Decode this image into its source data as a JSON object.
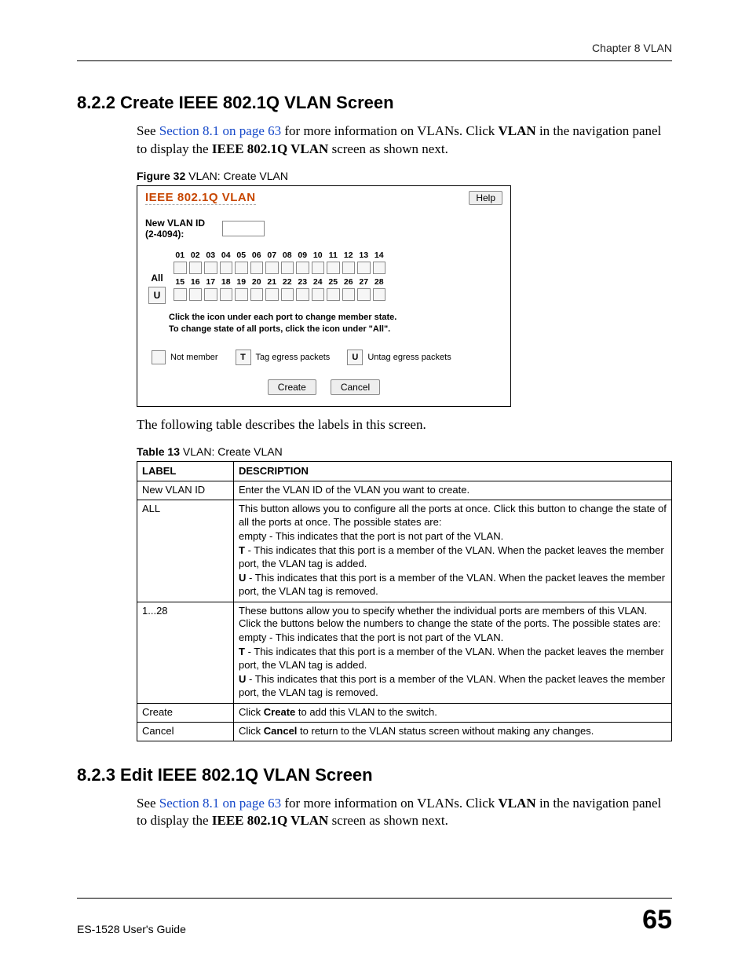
{
  "header": {
    "right": "Chapter 8 VLAN"
  },
  "s1": {
    "heading": "8.2.2  Create IEEE 802.1Q VLAN Screen",
    "p_pre": "See ",
    "p_link": "Section 8.1 on page 63",
    "p_post1": " for more information on VLANs. Click ",
    "p_bold1": "VLAN",
    "p_post2": " in the navigation panel to display the ",
    "p_bold2": "IEEE 802.1Q VLAN",
    "p_post3": " screen as shown next.",
    "fig_caption_b": "Figure 32",
    "fig_caption_rest": "   VLAN: Create VLAN"
  },
  "fig": {
    "title": "IEEE 802.1Q VLAN",
    "help": "Help",
    "new_vlan_label": "New VLAN ID (2-4094):",
    "all_label": "All",
    "all_box": "U",
    "ports_row1": [
      "01",
      "02",
      "03",
      "04",
      "05",
      "06",
      "07",
      "08",
      "09",
      "10",
      "11",
      "12",
      "13",
      "14"
    ],
    "ports_row2": [
      "15",
      "16",
      "17",
      "18",
      "19",
      "20",
      "21",
      "22",
      "23",
      "24",
      "25",
      "26",
      "27",
      "28"
    ],
    "hint1": "Click the icon under each port to change member state.",
    "hint2": "To change state of all ports, click the icon under \"All\".",
    "legend_not_member": "Not member",
    "legend_tag": "Tag egress packets",
    "legend_untag": "Untag egress packets",
    "legend_t": "T",
    "legend_u": "U",
    "btn_create": "Create",
    "btn_cancel": "Cancel"
  },
  "table_intro": "The following table describes the labels in this screen.",
  "table_caption_b": "Table 13",
  "table_caption_rest": "   VLAN: Create VLAN",
  "thead": {
    "label": "LABEL",
    "desc": "DESCRIPTION"
  },
  "rows": {
    "r1": {
      "label": "New VLAN ID",
      "desc": "Enter the VLAN ID of the VLAN you want to create."
    },
    "r2": {
      "label": "ALL",
      "d1": "This button allows you to configure all the ports at once. Click this button to change the state of all the ports at once. The possible states are:",
      "d2": "empty - This indicates that the port is not part of the VLAN.",
      "d3b": "T",
      "d3r": " - This indicates that this port is a member of the VLAN. When the packet leaves the member port, the VLAN tag is added.",
      "d4b": "U",
      "d4r": " - This indicates that this port is a member of the VLAN. When the packet leaves the member port, the VLAN tag is removed."
    },
    "r3": {
      "label": "1...28",
      "d1": "These buttons allow you to specify whether the individual ports are members of this VLAN. Click the buttons below the numbers to change the state of the ports. The possible states are:",
      "d2": "empty - This indicates that the port is not part of the VLAN.",
      "d3b": "T",
      "d3r": " - This indicates that this port is a member of the VLAN. When the packet leaves the member port, the VLAN tag is added.",
      "d4b": "U",
      "d4r": " - This indicates that this port is a member of the VLAN. When the packet leaves the member port, the VLAN tag is removed."
    },
    "r4": {
      "label": "Create",
      "d_pre": "Click ",
      "d_b": "Create",
      "d_post": " to add this VLAN to the switch."
    },
    "r5": {
      "label": "Cancel",
      "d_pre": "Click ",
      "d_b": "Cancel",
      "d_post": " to return to the VLAN status screen without making any changes."
    }
  },
  "s2": {
    "heading": "8.2.3  Edit IEEE 802.1Q VLAN Screen",
    "p_pre": "See ",
    "p_link": "Section 8.1 on page 63",
    "p_post1": " for more information on VLANs. Click ",
    "p_bold1": "VLAN",
    "p_post2": " in the navigation panel to display the ",
    "p_bold2": "IEEE 802.1Q VLAN",
    "p_post3": " screen as shown next."
  },
  "footer": {
    "left": "ES-1528 User's Guide",
    "right": "65"
  }
}
